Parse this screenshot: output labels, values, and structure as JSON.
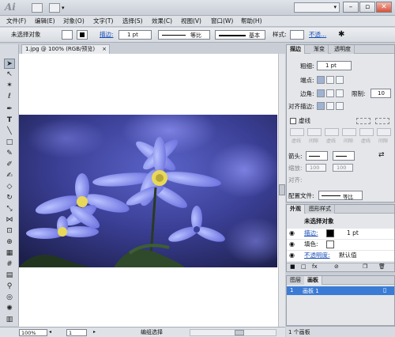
{
  "app": {
    "logo": "Ai"
  },
  "menu": [
    "文件(F)",
    "编辑(E)",
    "对象(O)",
    "文字(T)",
    "选择(S)",
    "效果(C)",
    "视图(V)",
    "窗口(W)",
    "帮助(H)"
  ],
  "control": {
    "selection_status": "未选择对象",
    "stroke_label": "描边:",
    "stroke_weight": "1 pt",
    "profile_label": "等比",
    "brush_label": "基本",
    "style_label": "样式:",
    "opacity_link": "不透..."
  },
  "document": {
    "tab_title": "1.jpg @ 100% (RGB/预览)",
    "zoom": "100%",
    "artboard_num": "1",
    "status_text": "编组选择"
  },
  "stroke_panel": {
    "tabs": [
      "描边",
      "渐变",
      "透明度"
    ],
    "weight_label": "粗细:",
    "weight_value": "1 pt",
    "cap_label": "端点:",
    "corner_label": "边角:",
    "limit_label": "限制:",
    "limit_value": "10",
    "align_label": "对齐描边:",
    "dash_label": "虚线",
    "dash_fields": [
      "虚线",
      "间隙",
      "虚线",
      "间隙",
      "虚线",
      "间隙"
    ],
    "arrow_label": "箭头:",
    "scale_label": "缩放:",
    "scale_value_1": "100",
    "scale_value_2": "100",
    "align_arrow_label": "对齐:",
    "profile_label": "配置文件:",
    "profile_value": "等比"
  },
  "appearance_panel": {
    "tabs": [
      "外观",
      "图形样式"
    ],
    "title": "未选择对象",
    "stroke_label": "描边:",
    "stroke_value": "1 pt",
    "fill_label": "填色:",
    "opacity_label": "不透明度:",
    "opacity_value": "默认值"
  },
  "layers_panel": {
    "tabs": [
      "图层",
      "画板"
    ],
    "row_num": "1",
    "row_name": "画板 1",
    "footer": "1 个画板"
  },
  "colors": {
    "chrome": "#d7dbe1",
    "panel": "#e4e6ea",
    "selection": "#3a7bd5",
    "link": "#1a4fb8"
  }
}
